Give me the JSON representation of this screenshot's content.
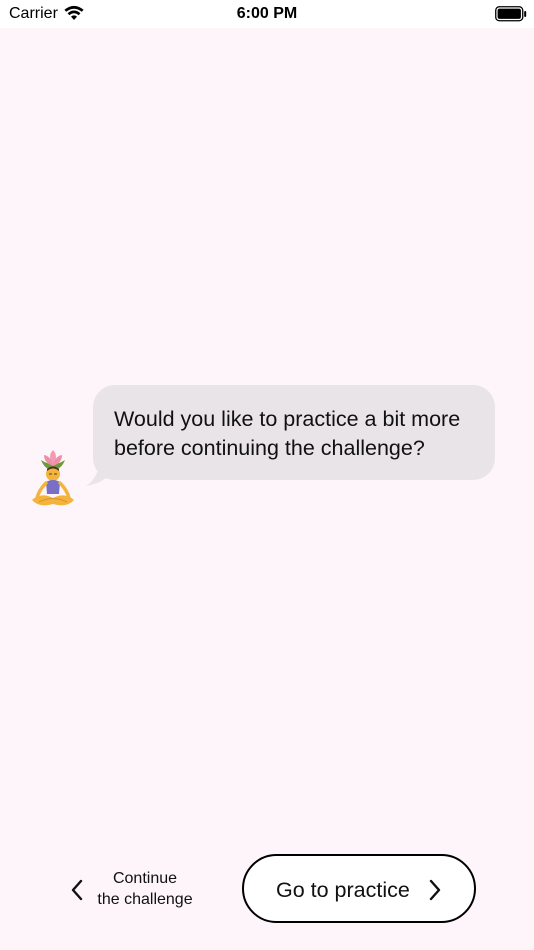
{
  "status_bar": {
    "carrier": "Carrier",
    "time": "6:00 PM",
    "icons": [
      "wifi-icon",
      "battery-icon"
    ]
  },
  "chat": {
    "avatar": "person-in-lotus-position-icon",
    "message": "Would you like to practice a bit more before continuing the challenge?"
  },
  "actions": {
    "continue": {
      "line1": "Continue",
      "line2": "the challenge",
      "icon": "chevron-left-icon"
    },
    "practice": {
      "label": "Go to practice",
      "icon": "chevron-right-icon"
    }
  },
  "colors": {
    "background": "#fdf5f9",
    "bubble": "#e8e4e7",
    "button_border": "#000000"
  }
}
